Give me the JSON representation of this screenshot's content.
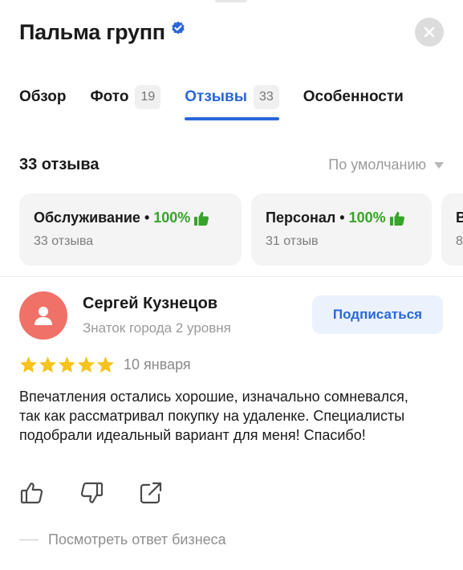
{
  "header": {
    "title": "Пальма групп"
  },
  "tabs": [
    {
      "label": "Обзор",
      "count": ""
    },
    {
      "label": "Фото",
      "count": "19"
    },
    {
      "label": "Отзывы",
      "count": "33"
    },
    {
      "label": "Особенности",
      "count": ""
    }
  ],
  "reviews": {
    "count_label": "33 отзыва",
    "sort_label": "По умолчанию"
  },
  "aspects": [
    {
      "name": "Обслуживание",
      "percent": "100%",
      "sub": "33 отзыва"
    },
    {
      "name": "Персонал",
      "percent": "100%",
      "sub": "31 отзыв"
    },
    {
      "name": "В",
      "percent": "",
      "sub": "8"
    }
  ],
  "review": {
    "author": "Сергей Кузнецов",
    "level": "Знаток города 2 уровня",
    "subscribe_label": "Подписаться",
    "rating": 5,
    "date": "10 января",
    "text": "Впечатления остались хорошие, изначально сомневался, так как рассматривал покупку на удаленке. Специалисты подобрали идеальный вариант для меня! Спасибо!",
    "business_reply_label": "Посмотреть ответ бизнеса"
  },
  "colors": {
    "accent": "#2a67d8",
    "positive": "#36a428",
    "star": "#f6c21c",
    "avatar": "#f07167"
  },
  "icons": {
    "verified": "verified-badge-icon",
    "close": "close-icon",
    "thumb_up": "thumb-up-icon",
    "thumb_down": "thumb-down-icon",
    "share": "share-icon",
    "avatar": "user-silhouette-icon"
  }
}
